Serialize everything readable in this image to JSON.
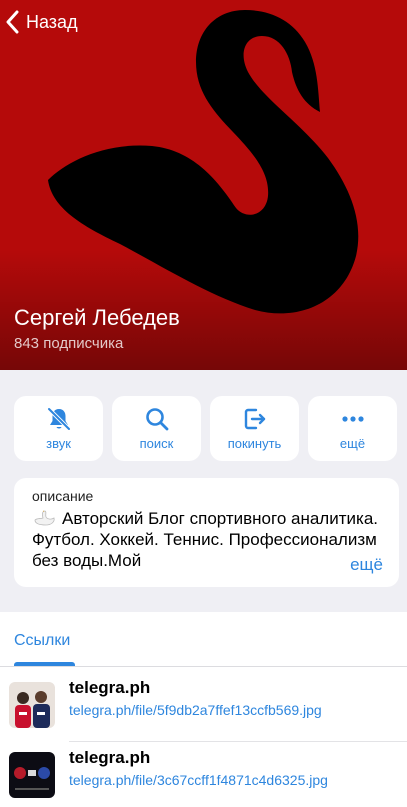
{
  "nav": {
    "back_label": "Назад"
  },
  "channel": {
    "name": "Сергей Лебедев",
    "subscribers": "843 подписчика",
    "brand_color": "#b50a0a",
    "accent_color": "#2e86de"
  },
  "actions": [
    {
      "label": "звук",
      "icon": "bell-slash-icon"
    },
    {
      "label": "поиск",
      "icon": "search-icon"
    },
    {
      "label": "покинуть",
      "icon": "leave-icon"
    },
    {
      "label": "ещё",
      "icon": "more-dots-icon"
    }
  ],
  "description": {
    "label": "описание",
    "text": "Авторский Блог спортивного аналитика. Футбол. Хоккей. Теннис. Профессионализм без воды.Мой",
    "more_label": "ещё"
  },
  "tabs": {
    "links_label": "Ссылки"
  },
  "links": [
    {
      "title": "telegra.ph",
      "url": "telegra.ph/file/5f9db2a7ffef13ccfb569.jpg"
    },
    {
      "title": "telegra.ph",
      "url": "telegra.ph/file/3c67ccff1f4871c4d6325.jpg"
    }
  ]
}
